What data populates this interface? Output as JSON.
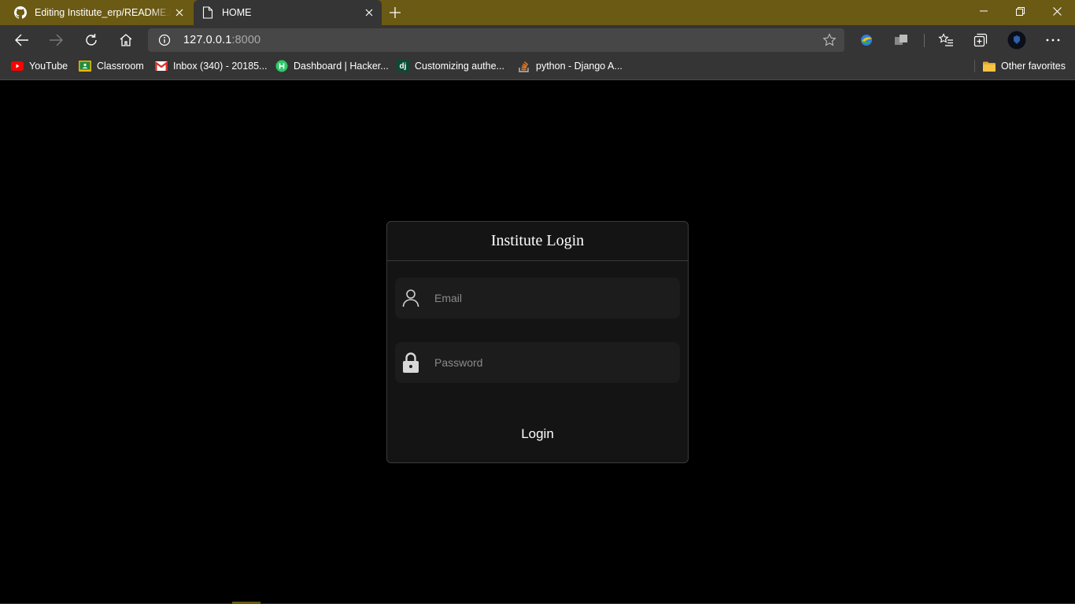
{
  "browser": {
    "tabs": [
      {
        "title": "Editing Institute_erp/README.md",
        "favicon": "github-icon",
        "active": false
      },
      {
        "title": "HOME",
        "favicon": "page-icon",
        "active": true
      }
    ],
    "url_host": "127.0.0.1",
    "url_port": ":8000",
    "favorites": [
      {
        "label": "YouTube",
        "icon": "youtube-icon",
        "color": "#ff0000"
      },
      {
        "label": "Classroom",
        "icon": "classroom-icon",
        "color": "#f4b400"
      },
      {
        "label": "Inbox (340) - 20185...",
        "icon": "gmail-icon",
        "color": "#d93025"
      },
      {
        "label": "Dashboard | Hacker...",
        "icon": "hackerrank-icon",
        "color": "#2ec866"
      },
      {
        "label": "Customizing authe...",
        "icon": "django-icon",
        "glyph": "dj",
        "color": "#0c4b33"
      },
      {
        "label": "python - Django A...",
        "icon": "stackoverflow-icon",
        "color": "#f48024"
      }
    ],
    "other_favorites": "Other favorites",
    "theme": {
      "tabstrip": "#6b5a14",
      "toolbar": "#353535",
      "omnibox": "#474747"
    }
  },
  "login": {
    "title": "Institute Login",
    "email_placeholder": "Email",
    "password_placeholder": "Password",
    "submit_label": "Login"
  }
}
